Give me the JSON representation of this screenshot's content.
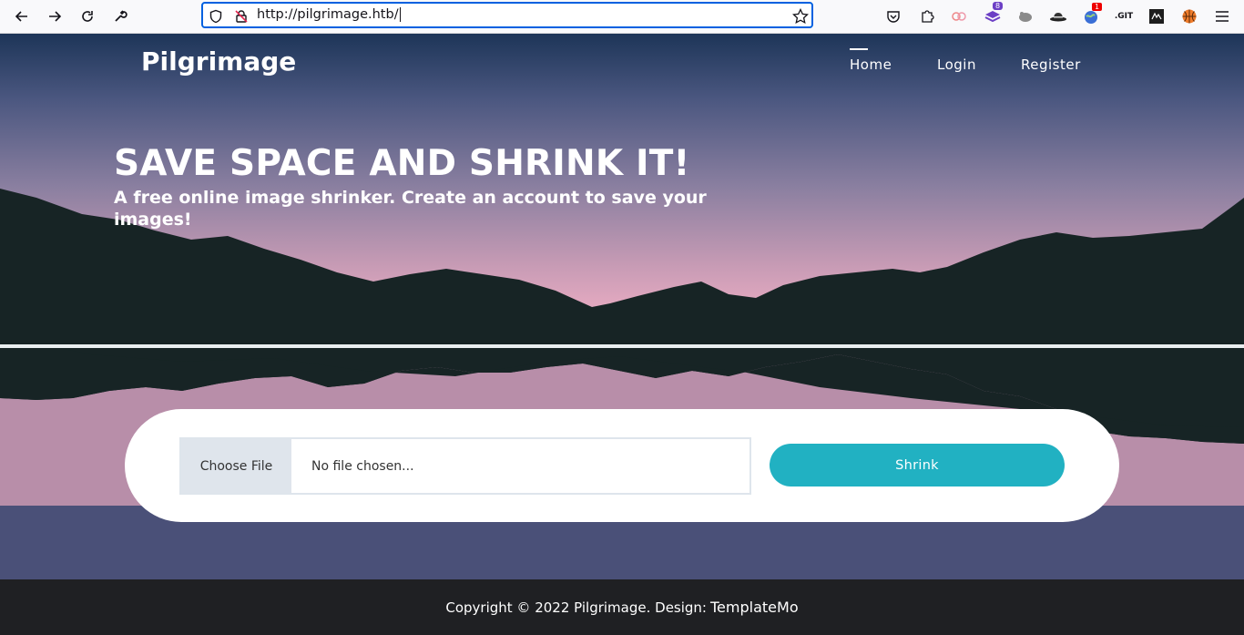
{
  "browser": {
    "url": "http://pilgrimage.htb/",
    "extension_badges": {
      "ext_purple": "8",
      "ext_red": "1"
    },
    "git_label": ".GIT"
  },
  "site": {
    "brand": "Pilgrimage",
    "nav": [
      {
        "label": "Home",
        "active": true
      },
      {
        "label": "Login",
        "active": false
      },
      {
        "label": "Register",
        "active": false
      }
    ]
  },
  "hero": {
    "title": "SAVE SPACE AND SHRINK IT!",
    "subtitle": "A free online image shrinker. Create an account to save your images!"
  },
  "upload": {
    "choose_label": "Choose File",
    "file_status": "No file chosen...",
    "submit_label": "Shrink"
  },
  "footer": {
    "text": "Copyright © 2022 Pilgrimage. Design:",
    "link": "TemplateMo"
  },
  "colors": {
    "accent": "#21b1c2",
    "footer_bg": "#1f2023",
    "mountains": "#172425"
  }
}
